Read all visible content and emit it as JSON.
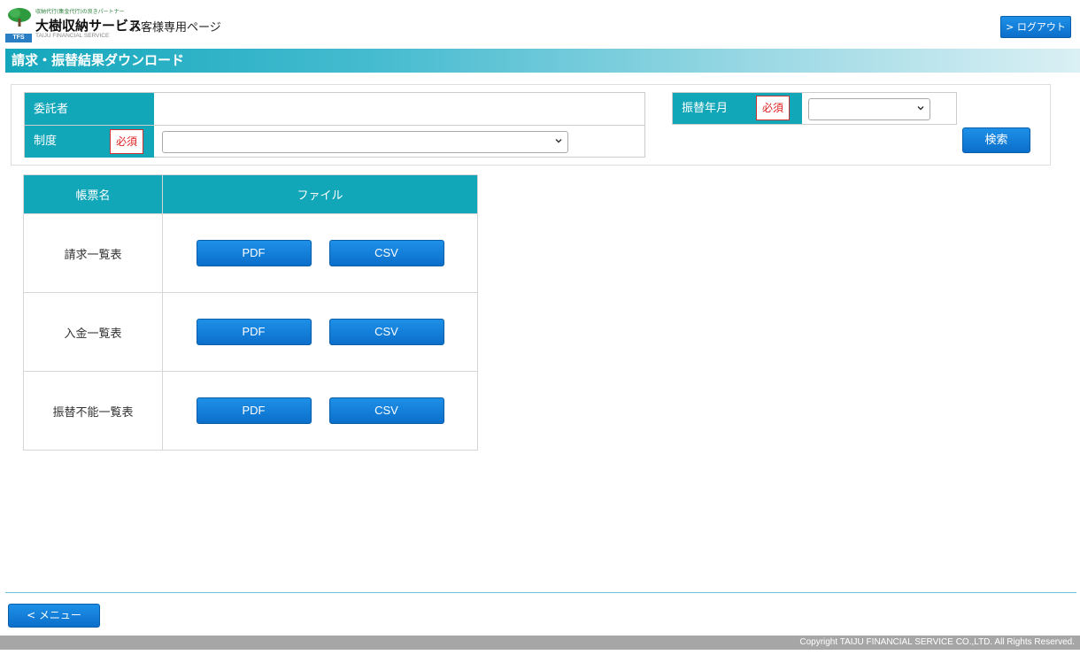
{
  "header": {
    "brand_tagline": "収納代行(集金代行)の良きパートナー",
    "brand_name": "大樹収納サービス",
    "brand_en": "TAIJU FINANCIAL SERVICE",
    "logo_badge": "TFS",
    "page_subtitle": "お客様専用ページ",
    "logout_label": "> ログアウト"
  },
  "page_title": "請求・振替結果ダウンロード",
  "search": {
    "consignor_label": "委託者",
    "consignor_value": "",
    "system_label": "制度",
    "system_required": "必須",
    "system_selected": "",
    "transfer_month_label": "振替年月",
    "transfer_month_required": "必須",
    "transfer_month_selected": "",
    "search_button": "検索"
  },
  "result_table": {
    "headers": [
      "帳票名",
      "ファイル"
    ],
    "rows": [
      {
        "name": "請求一覧表",
        "pdf": "PDF",
        "csv": "CSV"
      },
      {
        "name": "入金一覧表",
        "pdf": "PDF",
        "csv": "CSV"
      },
      {
        "name": "振替不能一覧表",
        "pdf": "PDF",
        "csv": "CSV"
      }
    ]
  },
  "footer": {
    "menu_button": "< メニュー",
    "copyright": "Copyright TAIJU FINANCIAL SERVICE CO.,LTD. All Rights Reserved."
  },
  "colors": {
    "accent": "#12a6b9",
    "button": "#1a86dc",
    "required_text": "#e02020"
  }
}
